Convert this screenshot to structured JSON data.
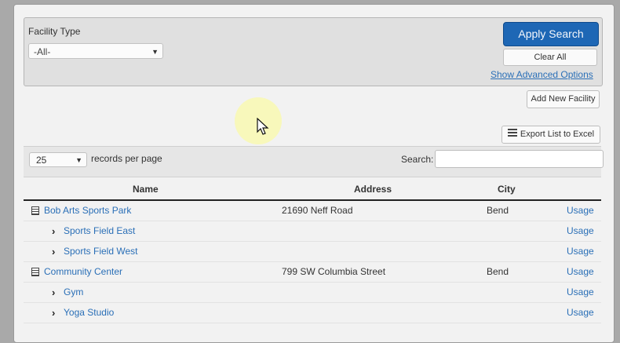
{
  "search": {
    "facility_type_label": "Facility Type",
    "facility_type_value": "-All-",
    "apply_label": "Apply Search",
    "clear_label": "Clear All",
    "advanced_label": "Show Advanced Options"
  },
  "actions": {
    "add_label": "Add New Facility",
    "export_label": "Export List to Excel"
  },
  "list_controls": {
    "per_page_value": "25",
    "per_page_label": "records per page",
    "search_label": "Search:"
  },
  "table": {
    "headers": [
      "Name",
      "Address",
      "City"
    ],
    "rows": [
      {
        "name": "Bob Arts Sports Park",
        "address": "21690 Neff Road",
        "city": "Bend",
        "usage": "Usage",
        "level": 0
      },
      {
        "name": "Sports Field East",
        "address": "",
        "city": "",
        "usage": "Usage",
        "level": 1
      },
      {
        "name": "Sports Field West",
        "address": "",
        "city": "",
        "usage": "Usage",
        "level": 1
      },
      {
        "name": "Community Center",
        "address": "799 SW Columbia Street",
        "city": "Bend",
        "usage": "Usage",
        "level": 0
      },
      {
        "name": "Gym",
        "address": "",
        "city": "",
        "usage": "Usage",
        "level": 1
      },
      {
        "name": "Yoga Studio",
        "address": "",
        "city": "",
        "usage": "Usage",
        "level": 1
      }
    ]
  },
  "icons": {
    "dropdown": "caret-down-icon",
    "export": "list-icon",
    "facility": "document-icon",
    "sub_facility": "chevron-right-icon",
    "pointer": "mouse-cursor-icon"
  },
  "colors": {
    "primary_button": "#1e67b5",
    "link": "#2a6fb7"
  }
}
